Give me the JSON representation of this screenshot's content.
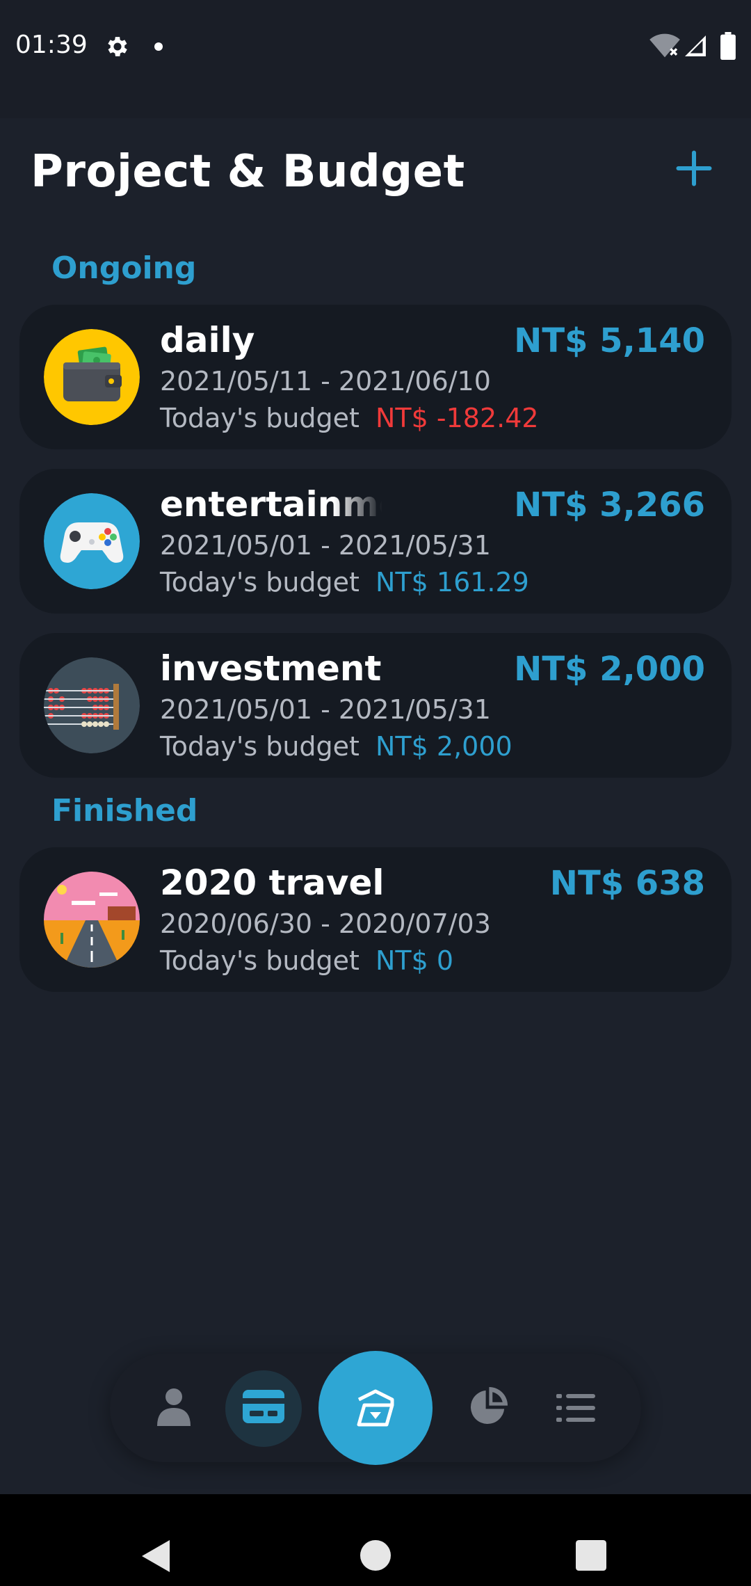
{
  "status_bar": {
    "time": "01:39",
    "icons": [
      "gear-icon",
      "notification-dot-icon",
      "wifi-off-icon",
      "cell-signal-icon",
      "battery-icon"
    ]
  },
  "header": {
    "title": "Project & Budget",
    "add_icon": "plus-icon"
  },
  "sections": [
    {
      "title": "Ongoing",
      "projects": [
        {
          "name": "daily",
          "amount": "NT$ 5,140",
          "dates": "2021/05/11 - 2021/06/10",
          "budget_label": "Today's budget",
          "budget_value": "NT$ -182.42",
          "budget_negative": true,
          "icon": "wallet-icon"
        },
        {
          "name": "entertainme",
          "amount": "NT$ 3,266",
          "dates": "2021/05/01 - 2021/05/31",
          "budget_label": "Today's budget",
          "budget_value": "NT$ 161.29",
          "budget_negative": false,
          "icon": "gamepad-icon"
        },
        {
          "name": "investment",
          "amount": "NT$ 2,000",
          "dates": "2021/05/01 - 2021/05/31",
          "budget_label": "Today's budget",
          "budget_value": "NT$ 2,000",
          "budget_negative": false,
          "icon": "abacus-icon"
        }
      ]
    },
    {
      "title": "Finished",
      "projects": [
        {
          "name": "2020 travel",
          "amount": "NT$ 638",
          "dates": "2020/06/30 - 2020/07/03",
          "budget_label": "Today's budget",
          "budget_value": "NT$ 0",
          "budget_negative": false,
          "icon": "desert-road-icon"
        }
      ]
    }
  ],
  "bottom_nav": {
    "items": [
      "person-icon",
      "card-icon",
      "project-icon",
      "pie-chart-icon",
      "menu-icon"
    ],
    "active": "project-icon"
  },
  "system_nav": [
    "back-icon",
    "home-icon",
    "recents-icon"
  ],
  "colors": {
    "background": "#1c212b",
    "card": "#151a22",
    "accent": "#2e9fcf",
    "negative": "#f03a3a",
    "muted_text": "#b4b9c2"
  }
}
